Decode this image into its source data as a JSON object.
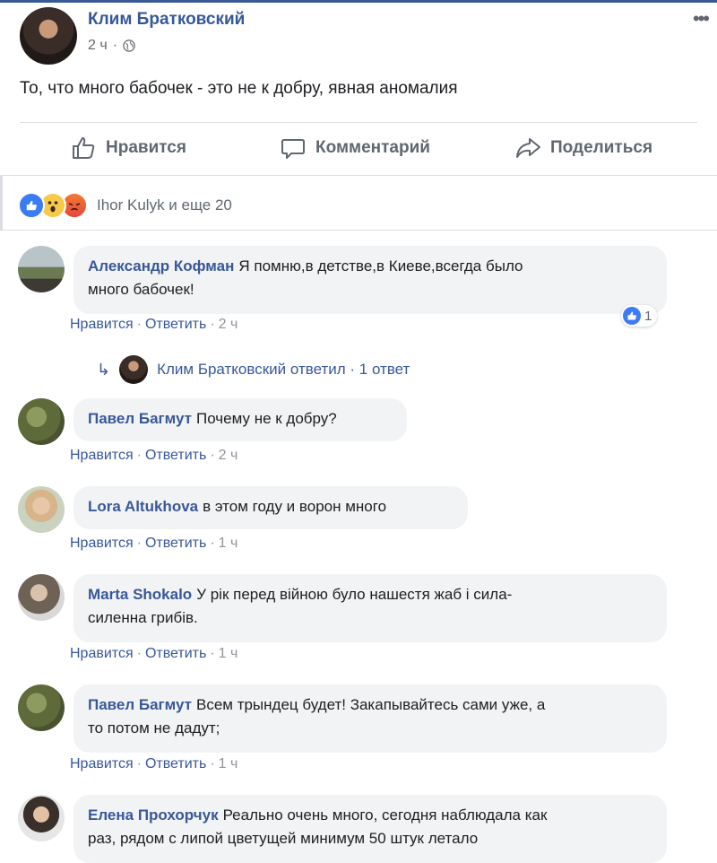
{
  "post": {
    "author": "Клим Братковский",
    "time": "2 ч",
    "text": "То, что много бабочек - это не к добру, явная аномалия",
    "more": "•••"
  },
  "actions": {
    "like": "Нравится",
    "comment": "Комментарий",
    "share": "Поделиться"
  },
  "reactions": {
    "summary": "Ihor Kulyk и еще 20"
  },
  "comment_actions": {
    "like": "Нравится",
    "reply": "Ответить",
    "separator": "·"
  },
  "comments": [
    {
      "name": "Александр Кофман",
      "text_line1": "Я помню,в детстве,в Киеве,всегда было",
      "text_line2": "много бабочек!",
      "time": "2 ч",
      "likes": "1"
    },
    {
      "name": "Павел Багмут",
      "text_line1": "Почему не к добру?",
      "time": "2 ч"
    },
    {
      "name": "Lora Altukhova",
      "text_line1": "в этом году и ворон много",
      "time": "1 ч"
    },
    {
      "name": "Marta Shokalo",
      "text_line1": "У рік перед війною було нашестя жаб і сила-",
      "text_line2": "силенна грибів.",
      "time": "1 ч"
    },
    {
      "name": "Павел Багмут",
      "text_line1": "Всем трындец будет! Закапывайтесь сами уже, а",
      "text_line2": "то потом не дадут;",
      "time": "1 ч"
    },
    {
      "name": "Елена Прохорчук",
      "text_line1": "Реально очень много, сегодня наблюдала как",
      "text_line2": "раз, рядом с липой цветущей минимум 50 штук летало"
    }
  ],
  "reply_summary": {
    "text": "Клим Братковский ответил · 1 ответ"
  },
  "colors": {
    "link": "#385898",
    "bubble": "#f2f3f5",
    "like": "#3b7cf5"
  }
}
